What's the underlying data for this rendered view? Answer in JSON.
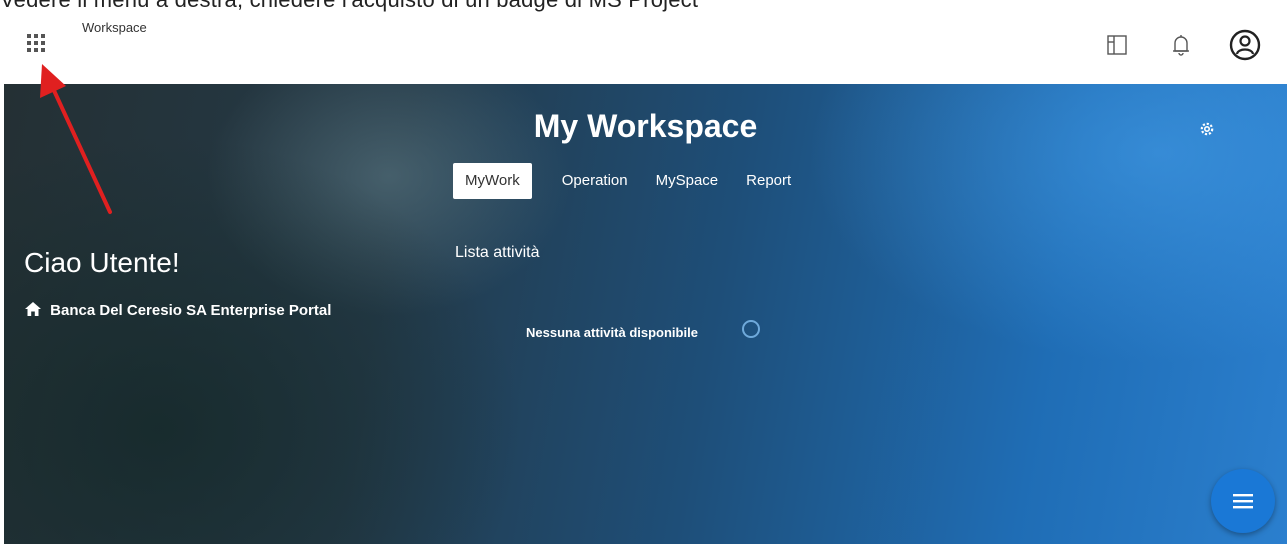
{
  "top_strip": {
    "text": "Vedere il menu a destra, chiedere l'acquisto di un badge di MS Project"
  },
  "header": {
    "app_title": "Workspace",
    "icons": [
      "apps-grid-icon",
      "panel-layout-icon",
      "bell-icon",
      "user-avatar-icon"
    ]
  },
  "hero": {
    "title": "My Workspace",
    "tabs": [
      "MyWork",
      "Operation",
      "MySpace",
      "Report"
    ],
    "active_tab": "MyWork",
    "greeting": "Ciao Utente!",
    "company_line": "Banca Del Ceresio SA Enterprise Portal",
    "list_title": "Lista attività",
    "empty_message": "Nessuna attività disponibile"
  },
  "colors": {
    "accent": "#1a78d6",
    "annotation_arrow": "#e02020",
    "header_bg": "#ffffff",
    "hero_dark": "#243034",
    "hero_blue": "#1f6db5"
  }
}
